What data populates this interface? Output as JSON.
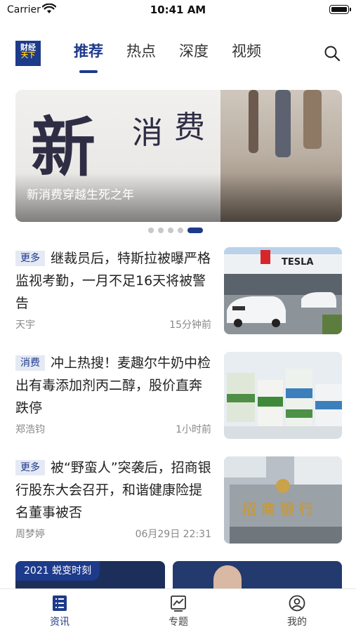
{
  "status_bar": {
    "carrier": "Carrier",
    "time": "10:41 AM"
  },
  "header": {
    "logo_line1": "财经",
    "logo_line2": "天下",
    "tabs": [
      {
        "label": "推荐",
        "active": true
      },
      {
        "label": "热点",
        "active": false
      },
      {
        "label": "深度",
        "active": false
      },
      {
        "label": "视频",
        "active": false
      }
    ],
    "search_icon": "search-icon"
  },
  "banner": {
    "image_text_1": "新",
    "image_text_2": "消",
    "image_text_3": "费",
    "caption": "新消费穿越生死之年",
    "slide_count": 5,
    "active_slide": 5
  },
  "news": [
    {
      "tag": "更多",
      "title": "继裁员后，特斯拉被曝严格监视考勤，一月不足16天将被警告",
      "author": "天宇",
      "time": "15分钟前",
      "thumb_text": "TESLA"
    },
    {
      "tag": "消费",
      "title": "冲上热搜！麦趣尔牛奶中检出有毒添加剂丙二醇，股价直奔跌停",
      "author": "郑浩钧",
      "time": "1小时前"
    },
    {
      "tag": "更多",
      "title": "被“野蛮人”突袭后，招商银行股东大会召开，和谐健康险提名董事被否",
      "author": "周梦婷",
      "time": "06月29日 22:31",
      "thumb_text": "招 商 银 行"
    }
  ],
  "bottom_cards": {
    "card_a_label": "2021 蜕变时刻"
  },
  "bottom_nav": [
    {
      "label": "资讯",
      "icon": "news-list-icon",
      "active": true
    },
    {
      "label": "专题",
      "icon": "chart-board-icon",
      "active": false
    },
    {
      "label": "我的",
      "icon": "user-icon",
      "active": false
    }
  ],
  "colors": {
    "accent": "#1e3a8a",
    "tag_bg": "#e4e9f4",
    "meta_text": "#888888"
  }
}
